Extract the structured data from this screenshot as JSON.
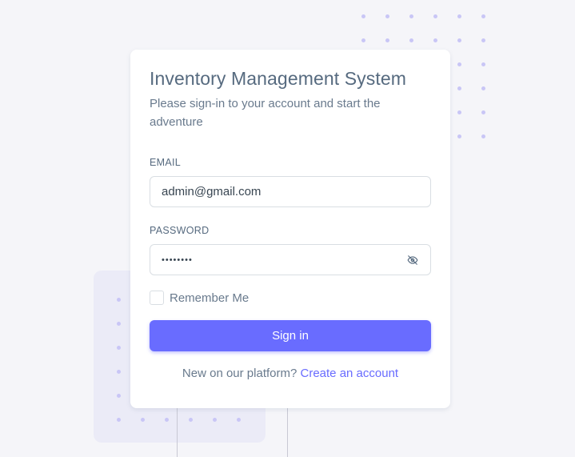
{
  "app": {
    "title": "Inventory Management System",
    "subtitle": "Please sign-in to your account and start the adventure"
  },
  "form": {
    "email_label": "EMAIL",
    "email_value": "admin@gmail.com",
    "password_label": "PASSWORD",
    "password_value": "••••••••",
    "password_toggle_icon": "eye-off-icon",
    "remember_label": "Remember Me",
    "remember_checked": false,
    "submit_label": "Sign in"
  },
  "footer": {
    "prompt_text": "New on our platform?",
    "link_text": "Create an account"
  },
  "colors": {
    "primary": "#696cff",
    "heading": "#566a7f",
    "body_text": "#697a8d",
    "background": "#f5f5f9",
    "card": "#ffffff",
    "border": "#d9dee3",
    "dot": "#c9c6f6"
  }
}
